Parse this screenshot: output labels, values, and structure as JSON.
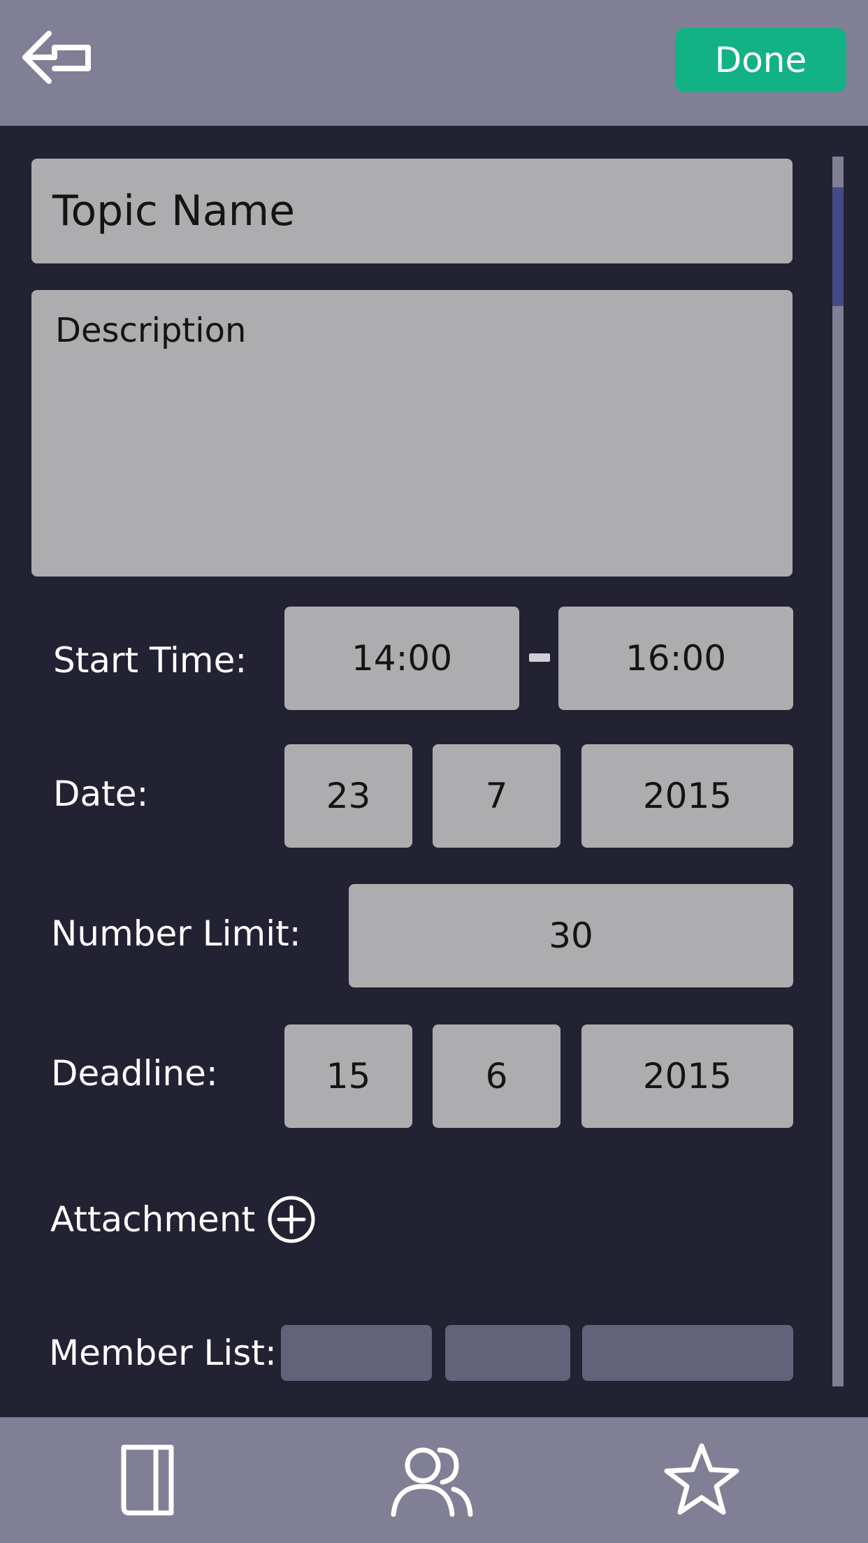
{
  "header": {
    "back_icon": "back-arrow-icon",
    "done_label": "Done",
    "done_color": "#12b285"
  },
  "form": {
    "topic_placeholder": "Topic Name",
    "description_placeholder": "Description",
    "start_time": {
      "label": "Start Time:",
      "from": "14:00",
      "to": "16:00"
    },
    "date": {
      "label": "Date:",
      "day": "23",
      "month": "7",
      "year": "2015"
    },
    "number_limit": {
      "label": "Number Limit:",
      "value": "30"
    },
    "deadline": {
      "label": "Deadline:",
      "day": "15",
      "month": "6",
      "year": "2015"
    },
    "attachment": {
      "label": "Attachment",
      "icon": "add-circle-icon"
    },
    "member_list": {
      "label": "Member List:"
    }
  },
  "tabbar": {
    "tabs": [
      {
        "icon": "notebook-icon"
      },
      {
        "icon": "people-icon"
      },
      {
        "icon": "star-icon"
      }
    ]
  },
  "colors": {
    "bar": "#807f96",
    "background": "#232233",
    "field": "#adadaf",
    "member_box": "#63627a",
    "scroll_thumb": "#444a88"
  }
}
